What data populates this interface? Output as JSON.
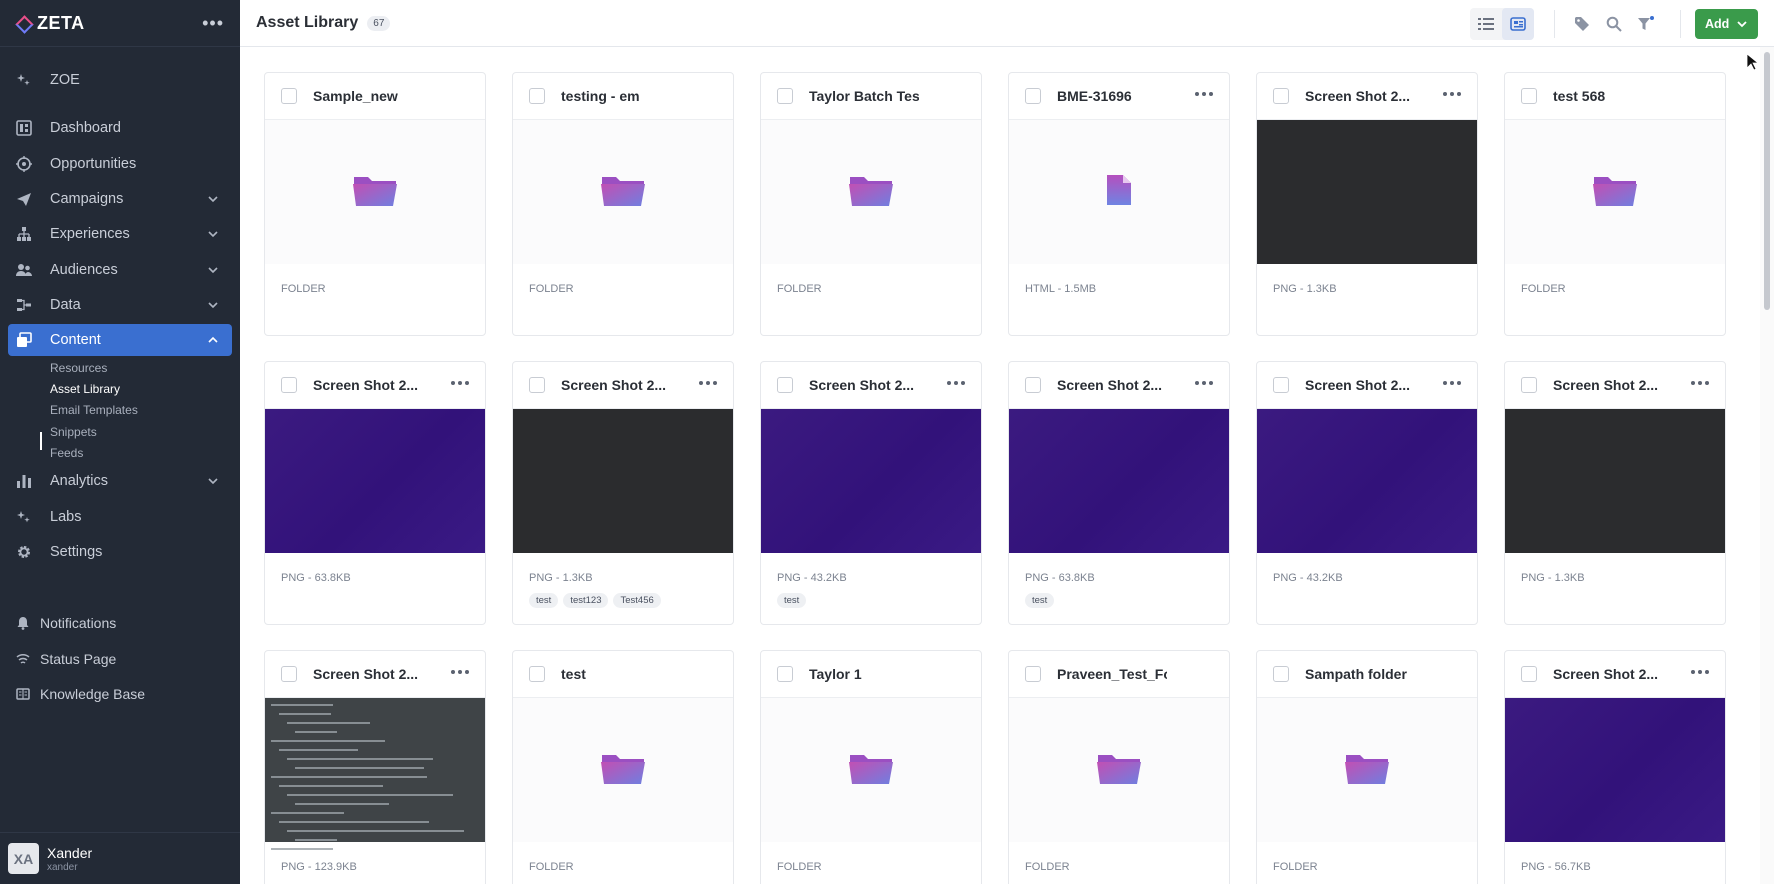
{
  "app": {
    "brand": "ZETA",
    "sidebar_more_icon": "dots-horizontal-icon",
    "zoe": "ZOE",
    "nav": [
      {
        "label": "Dashboard",
        "icon": "dashboard-icon"
      },
      {
        "label": "Opportunities",
        "icon": "target-icon"
      },
      {
        "label": "Campaigns",
        "icon": "paper-plane-icon"
      },
      {
        "label": "Experiences",
        "icon": "hierarchy-icon"
      },
      {
        "label": "Audiences",
        "icon": "users-icon"
      },
      {
        "label": "Data",
        "icon": "data-flow-icon"
      },
      {
        "label": "Content",
        "icon": "content-icon"
      },
      {
        "label": "Analytics",
        "icon": "bar-chart-icon"
      },
      {
        "label": "Labs",
        "icon": "sparkle-icon"
      },
      {
        "label": "Settings",
        "icon": "gear-icon"
      }
    ],
    "content_sub": [
      "Resources",
      "Asset Library",
      "Email Templates",
      "Snippets",
      "Feeds"
    ],
    "footer": [
      {
        "label": "Notifications",
        "icon": "bell-icon"
      },
      {
        "label": "Status Page",
        "icon": "signal-icon"
      },
      {
        "label": "Knowledge Base",
        "icon": "book-icon"
      }
    ],
    "user": {
      "initials": "XA",
      "name": "Xander",
      "handle": "xander"
    },
    "accent": "#3a6fd0",
    "sidebar_bg": "#232a36"
  },
  "header": {
    "title": "Asset Library",
    "count": "67",
    "add_label": "Add",
    "add_color": "#3a9b4b"
  },
  "cards": [
    {
      "title": "Sample_new",
      "type": "folder",
      "meta": "FOLDER",
      "tags": [],
      "menu": false
    },
    {
      "title": "testing - em",
      "type": "folder",
      "meta": "FOLDER",
      "tags": [],
      "menu": false
    },
    {
      "title": "Taylor Batch Test",
      "type": "folder",
      "meta": "FOLDER",
      "tags": [],
      "menu": false
    },
    {
      "title": "BME-31696",
      "type": "file",
      "meta": "HTML - 1.5MB",
      "tags": [],
      "menu": true
    },
    {
      "title": "Screen Shot 2...",
      "type": "dark",
      "meta": "PNG - 1.3KB",
      "tags": [],
      "menu": true
    },
    {
      "title": "test 568",
      "type": "folder",
      "meta": "FOLDER",
      "tags": [],
      "menu": false
    },
    {
      "title": "Screen Shot 2...",
      "type": "purple",
      "meta": "PNG - 63.8KB",
      "tags": [],
      "menu": true
    },
    {
      "title": "Screen Shot 2...",
      "type": "dark",
      "meta": "PNG - 1.3KB",
      "tags": [
        "test",
        "test123",
        "Test456"
      ],
      "menu": true
    },
    {
      "title": "Screen Shot 2...",
      "type": "purple",
      "meta": "PNG - 43.2KB",
      "tags": [
        "test"
      ],
      "menu": true
    },
    {
      "title": "Screen Shot 2...",
      "type": "purple",
      "meta": "PNG - 63.8KB",
      "tags": [
        "test"
      ],
      "menu": true
    },
    {
      "title": "Screen Shot 2...",
      "type": "purple",
      "meta": "PNG - 43.2KB",
      "tags": [],
      "menu": true
    },
    {
      "title": "Screen Shot 2...",
      "type": "dark",
      "meta": "PNG - 1.3KB",
      "tags": [],
      "menu": true
    },
    {
      "title": "Screen Shot 2...",
      "type": "doc",
      "meta": "PNG - 123.9KB",
      "tags": [],
      "menu": true
    },
    {
      "title": "test",
      "type": "folder",
      "meta": "FOLDER",
      "tags": [],
      "menu": false
    },
    {
      "title": "Taylor 1",
      "type": "folder",
      "meta": "FOLDER",
      "tags": [],
      "menu": false
    },
    {
      "title": "Praveen_Test_Folder",
      "type": "folder",
      "meta": "FOLDER",
      "tags": [],
      "menu": false
    },
    {
      "title": "Sampath folder",
      "type": "folder",
      "meta": "FOLDER",
      "tags": [],
      "menu": false
    },
    {
      "title": "Screen Shot 2...",
      "type": "purple",
      "meta": "PNG - 56.7KB",
      "tags": [],
      "menu": true
    }
  ]
}
